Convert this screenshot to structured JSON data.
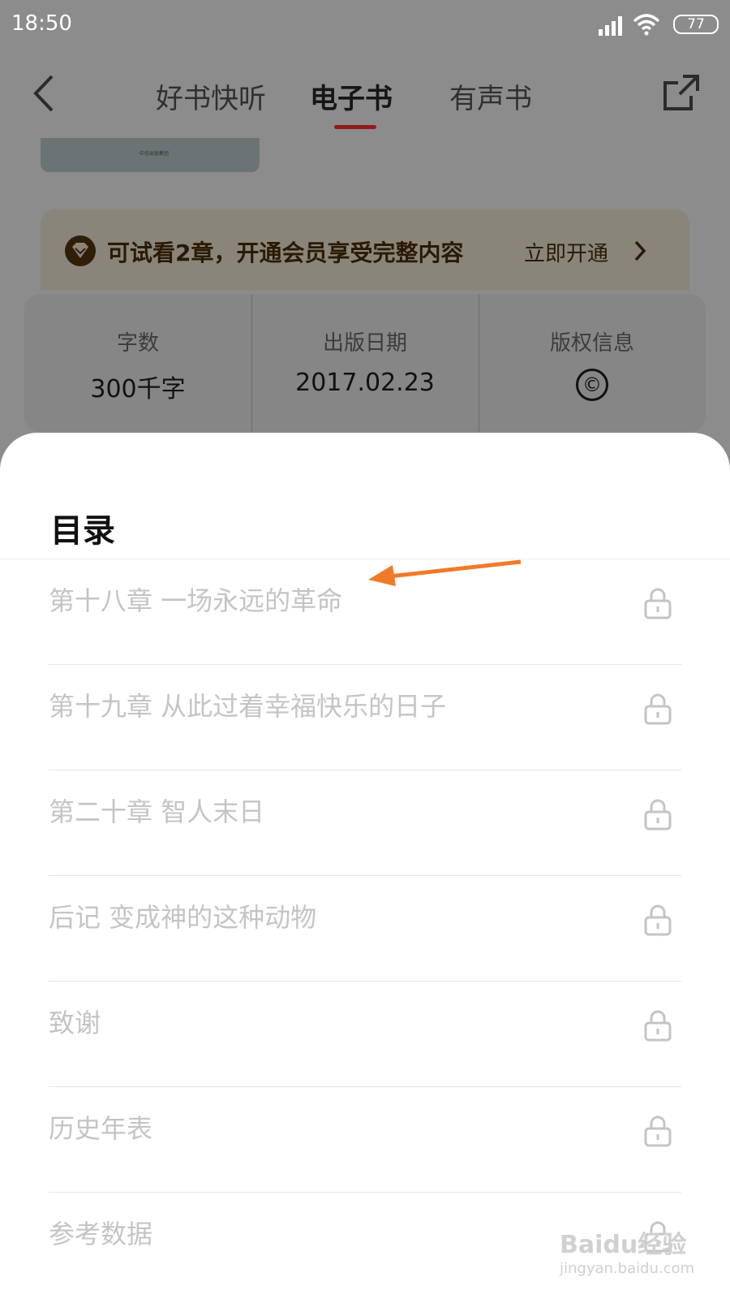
{
  "status_bar": {
    "time": "18:50",
    "battery": "77"
  },
  "nav": {
    "tabs": [
      "好书快听",
      "电子书",
      "有声书"
    ],
    "active_tab": "电子书"
  },
  "thumbnail_caption": "·中信出版集团",
  "vip_banner": {
    "text": "可试看2章，开通会员享受完整内容",
    "action": "立即开通"
  },
  "book_info": [
    {
      "label": "字数",
      "value": "300千字"
    },
    {
      "label": "出版日期",
      "value": "2017.02.23"
    },
    {
      "label": "版权信息",
      "value": "©"
    }
  ],
  "toc": {
    "title": "目录",
    "chapters": [
      "第十八章 一场永远的革命",
      "第十九章 从此过着幸福快乐的日子",
      "第二十章 智人末日",
      "后记 变成神的这种动物",
      "致谢",
      "历史年表",
      "参考数据"
    ]
  },
  "watermark": {
    "main": "Baidu经验",
    "sub": "jingyan.baidu.com"
  },
  "colors": {
    "accent": "#8f1c1c",
    "arrow": "#f07a2a",
    "chapter_text": "#c4c4c4"
  }
}
